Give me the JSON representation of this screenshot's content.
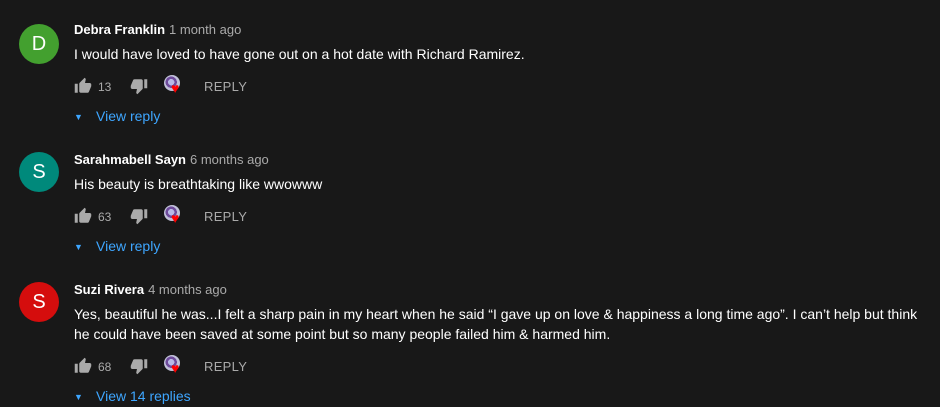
{
  "colors": {
    "background": "#181818",
    "text_primary": "#ffffff",
    "text_secondary": "#aaaaaa",
    "link": "#3ea6ff",
    "heart": "#ff0000"
  },
  "icons": {
    "like": "thumb-up-icon",
    "dislike": "thumb-down-icon",
    "creator_heart": "heart-icon",
    "expand": "chevron-down-icon"
  },
  "comments": [
    {
      "avatar_letter": "D",
      "avatar_color": "#43a02f",
      "author": "Debra Franklin",
      "time": "1 month ago",
      "text": "I would have loved to have gone out on a hot date with Richard Ramirez.",
      "likes": "13",
      "reply_label": "REPLY",
      "view_replies_label": "View reply"
    },
    {
      "avatar_letter": "S",
      "avatar_color": "#00897b",
      "author": "Sarahmabell Sayn",
      "time": "6 months ago",
      "text": "His beauty is breathtaking like wwowww",
      "likes": "63",
      "reply_label": "REPLY",
      "view_replies_label": "View reply"
    },
    {
      "avatar_letter": "S",
      "avatar_color": "#d50d0d",
      "author": "Suzi Rivera",
      "time": "4 months ago",
      "text": "Yes, beautiful he was...I felt a sharp pain in my heart when he said “I gave up on love & happiness a long time ago”. I can’t help but think he could have been saved at some point but so many people failed him & harmed him.",
      "likes": "68",
      "reply_label": "REPLY",
      "view_replies_label": "View 14 replies"
    }
  ]
}
